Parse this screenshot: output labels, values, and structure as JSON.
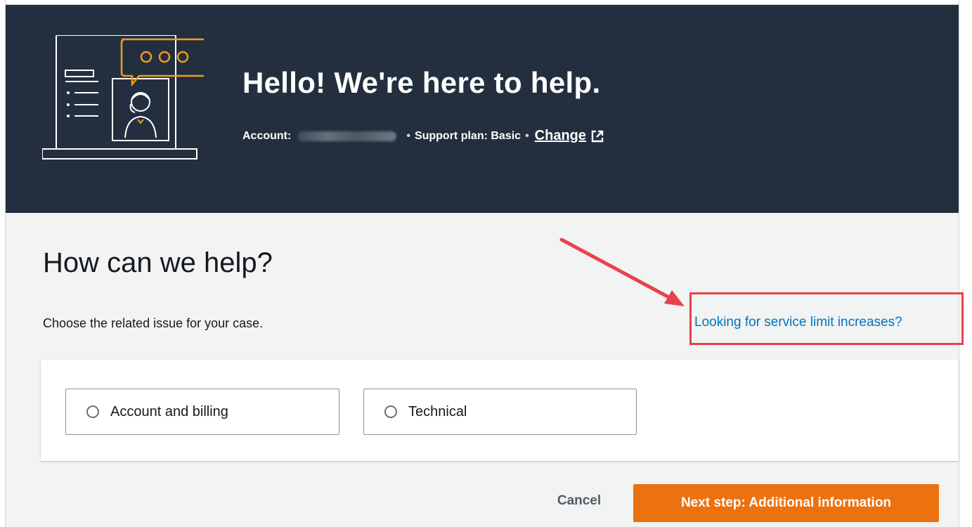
{
  "hero": {
    "title": "Hello!  We're here to help.",
    "account_label": "Account:",
    "separator": "•",
    "support_plan_text": "Support plan: Basic",
    "change_link": "Change",
    "illustration_icon": "support-agent-illustration",
    "external_link_icon": "external-link-icon",
    "background_color": "#232f3e",
    "accent_color": "#f29b18"
  },
  "main": {
    "heading": "How can we help?",
    "description": "Choose the related issue for your case.",
    "service_limit_link": "Looking for service limit increases?",
    "link_color": "#0073bb",
    "highlight_color": "#e8424b",
    "options": [
      {
        "label": "Account and billing",
        "selected": false
      },
      {
        "label": "Technical",
        "selected": false
      }
    ]
  },
  "actions": {
    "cancel_label": "Cancel",
    "next_label": "Next step: Additional information",
    "primary_color": "#ec7211"
  }
}
